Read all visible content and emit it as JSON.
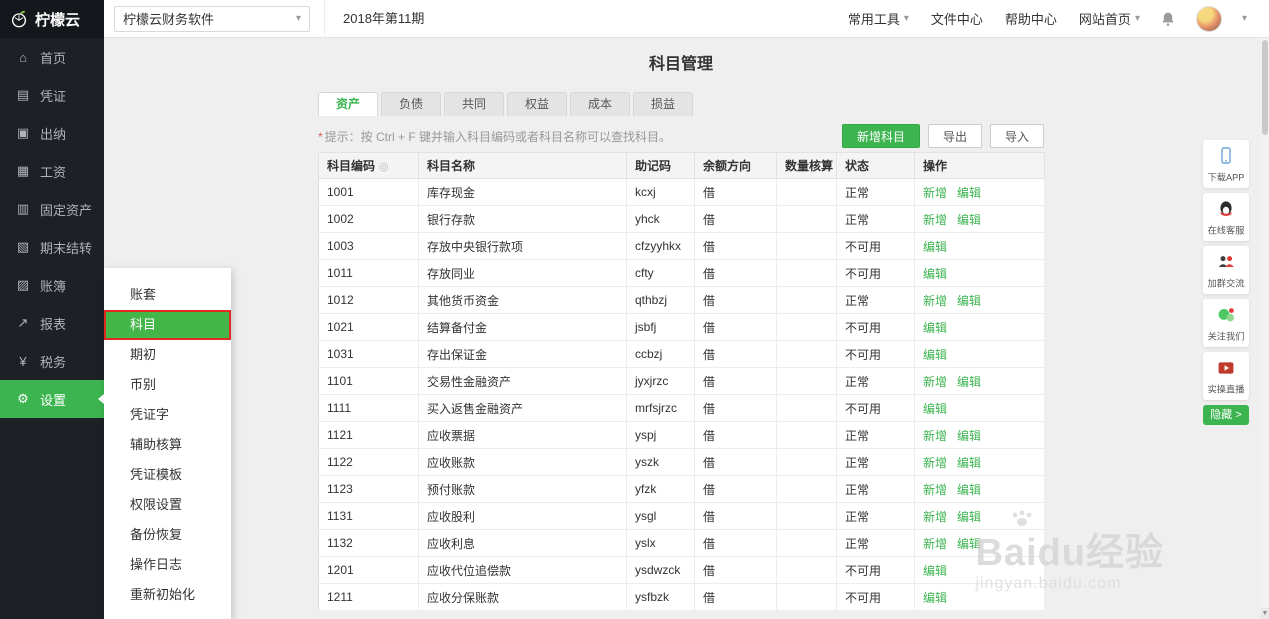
{
  "colors": {
    "accent_green": "#3cb450",
    "active_red_border": "#e02b22",
    "sidebar_dark": "#1d2126"
  },
  "topbar": {
    "logo_text": "柠檬云",
    "product_select": "柠檬云财务软件",
    "period": "2018年第11期",
    "menu": [
      {
        "id": "common-tools",
        "label": "常用工具",
        "caret": true
      },
      {
        "id": "file-center",
        "label": "文件中心",
        "caret": false
      },
      {
        "id": "help-center",
        "label": "帮助中心",
        "caret": false
      },
      {
        "id": "site-home",
        "label": "网站首页",
        "caret": true
      }
    ]
  },
  "sidebar": {
    "items": [
      {
        "id": "home",
        "label": "首页",
        "icon": "home-icon",
        "active": false
      },
      {
        "id": "voucher",
        "label": "凭证",
        "icon": "voucher-icon",
        "active": false
      },
      {
        "id": "cashier",
        "label": "出纳",
        "icon": "cashier-icon",
        "active": false
      },
      {
        "id": "salary",
        "label": "工资",
        "icon": "salary-icon",
        "active": false
      },
      {
        "id": "fixed-assets",
        "label": "固定资产",
        "icon": "building-icon",
        "active": false
      },
      {
        "id": "period-end",
        "label": "期末结转",
        "icon": "calendar-icon",
        "active": false
      },
      {
        "id": "ledger",
        "label": "账簿",
        "icon": "ledger-icon",
        "active": false
      },
      {
        "id": "report",
        "label": "报表",
        "icon": "chart-icon",
        "active": false
      },
      {
        "id": "tax",
        "label": "税务",
        "icon": "tax-icon",
        "active": false
      },
      {
        "id": "settings",
        "label": "设置",
        "icon": "gear-icon",
        "active": true
      }
    ]
  },
  "submenu": {
    "items": [
      {
        "id": "account-set",
        "label": "账套",
        "active": false
      },
      {
        "id": "subjects",
        "label": "科目",
        "active": true
      },
      {
        "id": "opening-balance",
        "label": "期初",
        "active": false
      },
      {
        "id": "currency",
        "label": "币别",
        "active": false
      },
      {
        "id": "voucher-word",
        "label": "凭证字",
        "active": false
      },
      {
        "id": "auxiliary-accounting",
        "label": "辅助核算",
        "active": false
      },
      {
        "id": "voucher-template",
        "label": "凭证模板",
        "active": false
      },
      {
        "id": "permission-settings",
        "label": "权限设置",
        "active": false
      },
      {
        "id": "backup-restore",
        "label": "备份恢复",
        "active": false
      },
      {
        "id": "operation-log",
        "label": "操作日志",
        "active": false
      },
      {
        "id": "reinitialize",
        "label": "重新初始化",
        "active": false
      }
    ]
  },
  "main": {
    "title": "科目管理",
    "tabs": [
      {
        "id": "assets",
        "label": "资产",
        "active": true
      },
      {
        "id": "liabilities",
        "label": "负债",
        "active": false
      },
      {
        "id": "common",
        "label": "共同",
        "active": false
      },
      {
        "id": "equity",
        "label": "权益",
        "active": false
      },
      {
        "id": "cost",
        "label": "成本",
        "active": false
      },
      {
        "id": "profit-loss",
        "label": "损益",
        "active": false
      }
    ],
    "hint_star": "*",
    "hint_text": "提示：按 Ctrl + F 键并输入科目编码或者科目名称可以查找科目。",
    "buttons": {
      "add": "新增科目",
      "export": "导出",
      "import": "导入"
    },
    "table": {
      "headers": [
        "科目编码",
        "科目名称",
        "助记码",
        "余额方向",
        "数量核算",
        "状态",
        "操作"
      ],
      "rows": [
        {
          "code": "1001",
          "name": "库存现金",
          "mnemonic": "kcxj",
          "direction": "借",
          "qty": "",
          "status": "正常",
          "actions": [
            "新增",
            "编辑"
          ]
        },
        {
          "code": "1002",
          "name": "银行存款",
          "mnemonic": "yhck",
          "direction": "借",
          "qty": "",
          "status": "正常",
          "actions": [
            "新增",
            "编辑"
          ]
        },
        {
          "code": "1003",
          "name": "存放中央银行款项",
          "mnemonic": "cfzyyhkx",
          "direction": "借",
          "qty": "",
          "status": "不可用",
          "actions": [
            "编辑"
          ]
        },
        {
          "code": "1011",
          "name": "存放同业",
          "mnemonic": "cfty",
          "direction": "借",
          "qty": "",
          "status": "不可用",
          "actions": [
            "编辑"
          ]
        },
        {
          "code": "1012",
          "name": "其他货币资金",
          "mnemonic": "qthbzj",
          "direction": "借",
          "qty": "",
          "status": "正常",
          "actions": [
            "新增",
            "编辑"
          ]
        },
        {
          "code": "1021",
          "name": "结算备付金",
          "mnemonic": "jsbfj",
          "direction": "借",
          "qty": "",
          "status": "不可用",
          "actions": [
            "编辑"
          ]
        },
        {
          "code": "1031",
          "name": "存出保证金",
          "mnemonic": "ccbzj",
          "direction": "借",
          "qty": "",
          "status": "不可用",
          "actions": [
            "编辑"
          ]
        },
        {
          "code": "1101",
          "name": "交易性金融资产",
          "mnemonic": "jyxjrzc",
          "direction": "借",
          "qty": "",
          "status": "正常",
          "actions": [
            "新增",
            "编辑"
          ]
        },
        {
          "code": "1111",
          "name": "买入返售金融资产",
          "mnemonic": "mrfsjrzc",
          "direction": "借",
          "qty": "",
          "status": "不可用",
          "actions": [
            "编辑"
          ]
        },
        {
          "code": "1121",
          "name": "应收票据",
          "mnemonic": "yspj",
          "direction": "借",
          "qty": "",
          "status": "正常",
          "actions": [
            "新增",
            "编辑"
          ]
        },
        {
          "code": "1122",
          "name": "应收账款",
          "mnemonic": "yszk",
          "direction": "借",
          "qty": "",
          "status": "正常",
          "actions": [
            "新增",
            "编辑"
          ]
        },
        {
          "code": "1123",
          "name": "预付账款",
          "mnemonic": "yfzk",
          "direction": "借",
          "qty": "",
          "status": "正常",
          "actions": [
            "新增",
            "编辑"
          ]
        },
        {
          "code": "1131",
          "name": "应收股利",
          "mnemonic": "ysgl",
          "direction": "借",
          "qty": "",
          "status": "正常",
          "actions": [
            "新增",
            "编辑"
          ]
        },
        {
          "code": "1132",
          "name": "应收利息",
          "mnemonic": "yslx",
          "direction": "借",
          "qty": "",
          "status": "正常",
          "actions": [
            "新增",
            "编辑"
          ]
        },
        {
          "code": "1201",
          "name": "应收代位追偿款",
          "mnemonic": "ysdwzck",
          "direction": "借",
          "qty": "",
          "status": "不可用",
          "actions": [
            "编辑"
          ]
        },
        {
          "code": "1211",
          "name": "应收分保账款",
          "mnemonic": "ysfbzk",
          "direction": "借",
          "qty": "",
          "status": "不可用",
          "actions": [
            "编辑"
          ]
        }
      ]
    }
  },
  "floatbar": {
    "items": [
      {
        "id": "download-app",
        "label": "下载APP",
        "icon": "phone-icon"
      },
      {
        "id": "online-service",
        "label": "在线客服",
        "icon": "qq-icon"
      },
      {
        "id": "join-group",
        "label": "加群交流",
        "icon": "group-icon"
      },
      {
        "id": "follow-us",
        "label": "关注我们",
        "icon": "wechat-icon"
      },
      {
        "id": "live-stream",
        "label": "实操直播",
        "icon": "live-icon"
      }
    ],
    "hide_label": "隐藏 >"
  },
  "watermark": {
    "title": "Baidu经验",
    "subtitle": "jingyan.baidu.com"
  }
}
